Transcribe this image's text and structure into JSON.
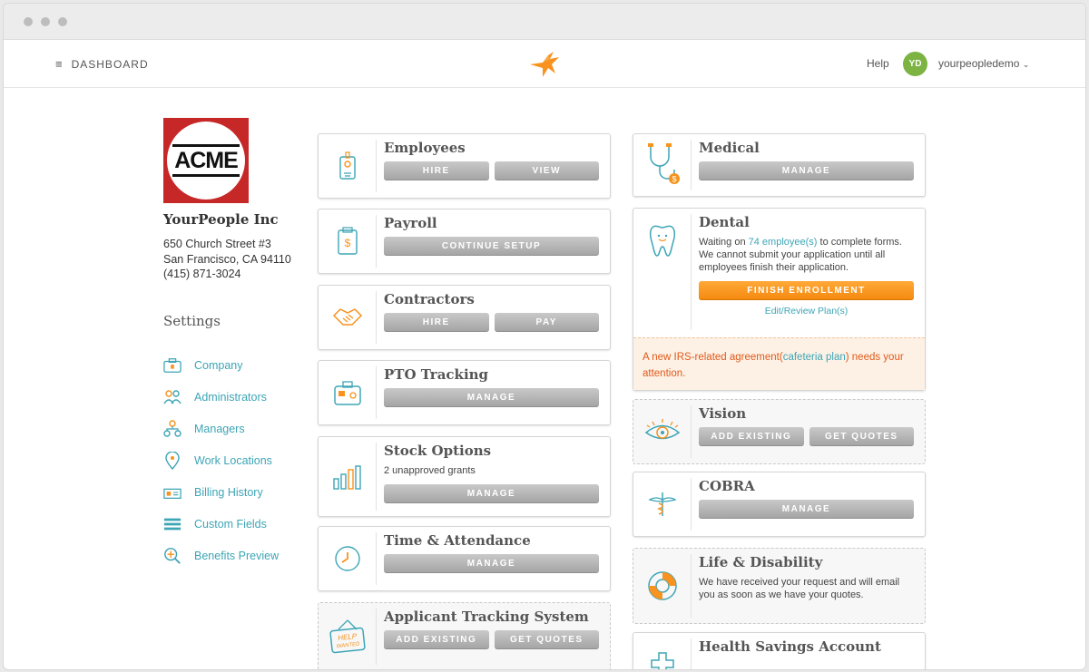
{
  "topbar": {
    "menu_label": "DASHBOARD",
    "help_label": "Help",
    "avatar_initials": "YD",
    "username": "yourpeopledemo",
    "brand_color": "#f7931e"
  },
  "company": {
    "logo_text": "ACME",
    "name": "YourPeople Inc",
    "address_line1": "650 Church Street #3",
    "address_line2": "San Francisco, CA 94110",
    "phone": "(415) 871-3024"
  },
  "settings": {
    "title": "Settings",
    "items": [
      {
        "label": "Company",
        "icon": "briefcase-icon"
      },
      {
        "label": "Administrators",
        "icon": "people-icon"
      },
      {
        "label": "Managers",
        "icon": "org-chart-icon"
      },
      {
        "label": "Work Locations",
        "icon": "location-pin-icon"
      },
      {
        "label": "Billing History",
        "icon": "billing-icon"
      },
      {
        "label": "Custom Fields",
        "icon": "fields-icon"
      },
      {
        "label": "Benefits Preview",
        "icon": "magnifier-icon"
      }
    ]
  },
  "cards": {
    "employees": {
      "title": "Employees",
      "btn1": "HIRE",
      "btn2": "VIEW"
    },
    "payroll": {
      "title": "Payroll",
      "btn1": "CONTINUE SETUP"
    },
    "contractors": {
      "title": "Contractors",
      "btn1": "HIRE",
      "btn2": "PAY"
    },
    "pto": {
      "title": "PTO Tracking",
      "btn1": "MANAGE"
    },
    "stock": {
      "title": "Stock Options",
      "note": "2 unapproved grants",
      "btn1": "MANAGE"
    },
    "time": {
      "title": "Time & Attendance",
      "btn1": "MANAGE"
    },
    "ats": {
      "title": "Applicant Tracking System",
      "btn1": "ADD EXISTING",
      "btn2": "GET QUOTES"
    },
    "medical": {
      "title": "Medical",
      "btn1": "MANAGE"
    },
    "dental": {
      "title": "Dental",
      "msg_pre": "Waiting on ",
      "msg_link": "74 employee(s)",
      "msg_post": " to complete forms. We cannot submit your application until all employees finish their application.",
      "btn1": "FINISH ENROLLMENT",
      "edit_link": "Edit/Review Plan(s)",
      "alert_pre": "A new IRS-related agreement(",
      "alert_link": "cafeteria plan",
      "alert_post": ") needs your attention."
    },
    "vision": {
      "title": "Vision",
      "btn1": "ADD EXISTING",
      "btn2": "GET QUOTES"
    },
    "cobra": {
      "title": "COBRA",
      "btn1": "MANAGE"
    },
    "life": {
      "title": "Life & Disability",
      "note": "We have received your request and will email you as soon as we have your quotes."
    },
    "hsa": {
      "title": "Health Savings Account"
    }
  }
}
